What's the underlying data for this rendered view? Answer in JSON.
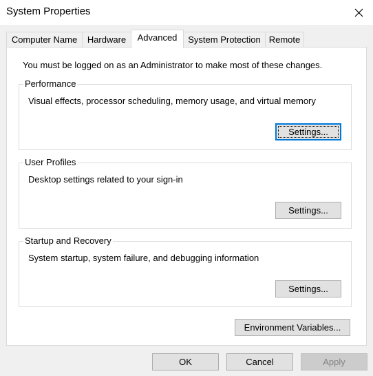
{
  "window": {
    "title": "System Properties",
    "close_icon": "close-icon"
  },
  "tabs": [
    {
      "label": "Computer Name",
      "active": false
    },
    {
      "label": "Hardware",
      "active": false
    },
    {
      "label": "Advanced",
      "active": true
    },
    {
      "label": "System Protection",
      "active": false
    },
    {
      "label": "Remote",
      "active": false
    }
  ],
  "advanced": {
    "admin_note": "You must be logged on as an Administrator to make most of these changes.",
    "performance": {
      "label": "Performance",
      "description": "Visual effects, processor scheduling, memory usage, and virtual memory",
      "button": "Settings..."
    },
    "user_profiles": {
      "label": "User Profiles",
      "description": "Desktop settings related to your sign-in",
      "button": "Settings..."
    },
    "startup_recovery": {
      "label": "Startup and Recovery",
      "description": "System startup, system failure, and debugging information",
      "button": "Settings..."
    },
    "env_button": "Environment Variables..."
  },
  "footer": {
    "ok": "OK",
    "cancel": "Cancel",
    "apply": "Apply",
    "apply_disabled": true
  }
}
